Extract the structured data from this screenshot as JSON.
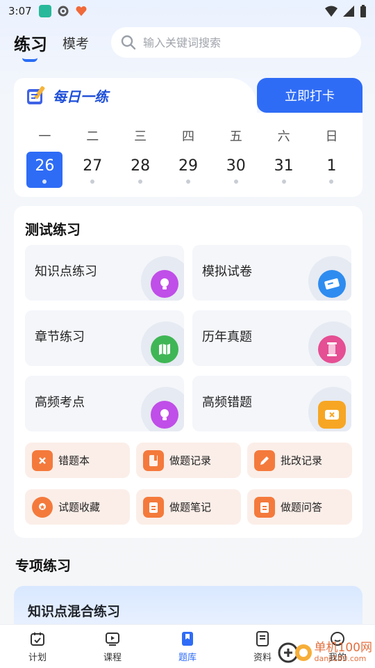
{
  "status_bar": {
    "time": "3:07"
  },
  "header": {
    "tabs": [
      {
        "label": "练习"
      },
      {
        "label": "模考"
      }
    ],
    "search_placeholder": "输入关键词搜索"
  },
  "daily": {
    "title": "每日一练",
    "checkin_label": "立即打卡",
    "weekdays": [
      "一",
      "二",
      "三",
      "四",
      "五",
      "六",
      "日"
    ],
    "dates": [
      "26",
      "27",
      "28",
      "29",
      "30",
      "31",
      "1"
    ],
    "active_index": 0
  },
  "test_practice": {
    "title": "测试练习",
    "items": [
      {
        "label": "知识点练习",
        "icon": "lightbulb-icon",
        "color": "#c04ee8"
      },
      {
        "label": "模拟试卷",
        "icon": "ticket-icon",
        "color": "#2e8cf0"
      },
      {
        "label": "章节练习",
        "icon": "map-icon",
        "color": "#3fb655"
      },
      {
        "label": "历年真题",
        "icon": "hourglass-icon",
        "color": "#e54f93"
      },
      {
        "label": "高频考点",
        "icon": "lightbulb-icon",
        "color": "#c04ee8"
      },
      {
        "label": "高频错题",
        "icon": "error-ticket-icon",
        "color": "#f6a623"
      }
    ],
    "chips": [
      {
        "label": "错题本",
        "icon": "wrong-book-icon"
      },
      {
        "label": "做题记录",
        "icon": "record-icon"
      },
      {
        "label": "批改记录",
        "icon": "pencil-icon"
      },
      {
        "label": "试题收藏",
        "icon": "medal-icon"
      },
      {
        "label": "做题笔记",
        "icon": "notes-icon"
      },
      {
        "label": "做题问答",
        "icon": "qa-icon"
      }
    ],
    "chip_color": "#f47a3c"
  },
  "special": {
    "title": "专项练习",
    "card_title": "知识点混合练习"
  },
  "bottom_nav": {
    "items": [
      {
        "label": "计划",
        "icon": "calendar-icon"
      },
      {
        "label": "课程",
        "icon": "video-icon"
      },
      {
        "label": "题库",
        "icon": "bookmark-icon"
      },
      {
        "label": "资料",
        "icon": "document-icon"
      },
      {
        "label": "我的",
        "icon": "profile-icon"
      }
    ],
    "active_index": 2,
    "active_color": "#2f6cf6"
  },
  "watermark": {
    "text": "单机100网",
    "url": "danji100.com"
  }
}
